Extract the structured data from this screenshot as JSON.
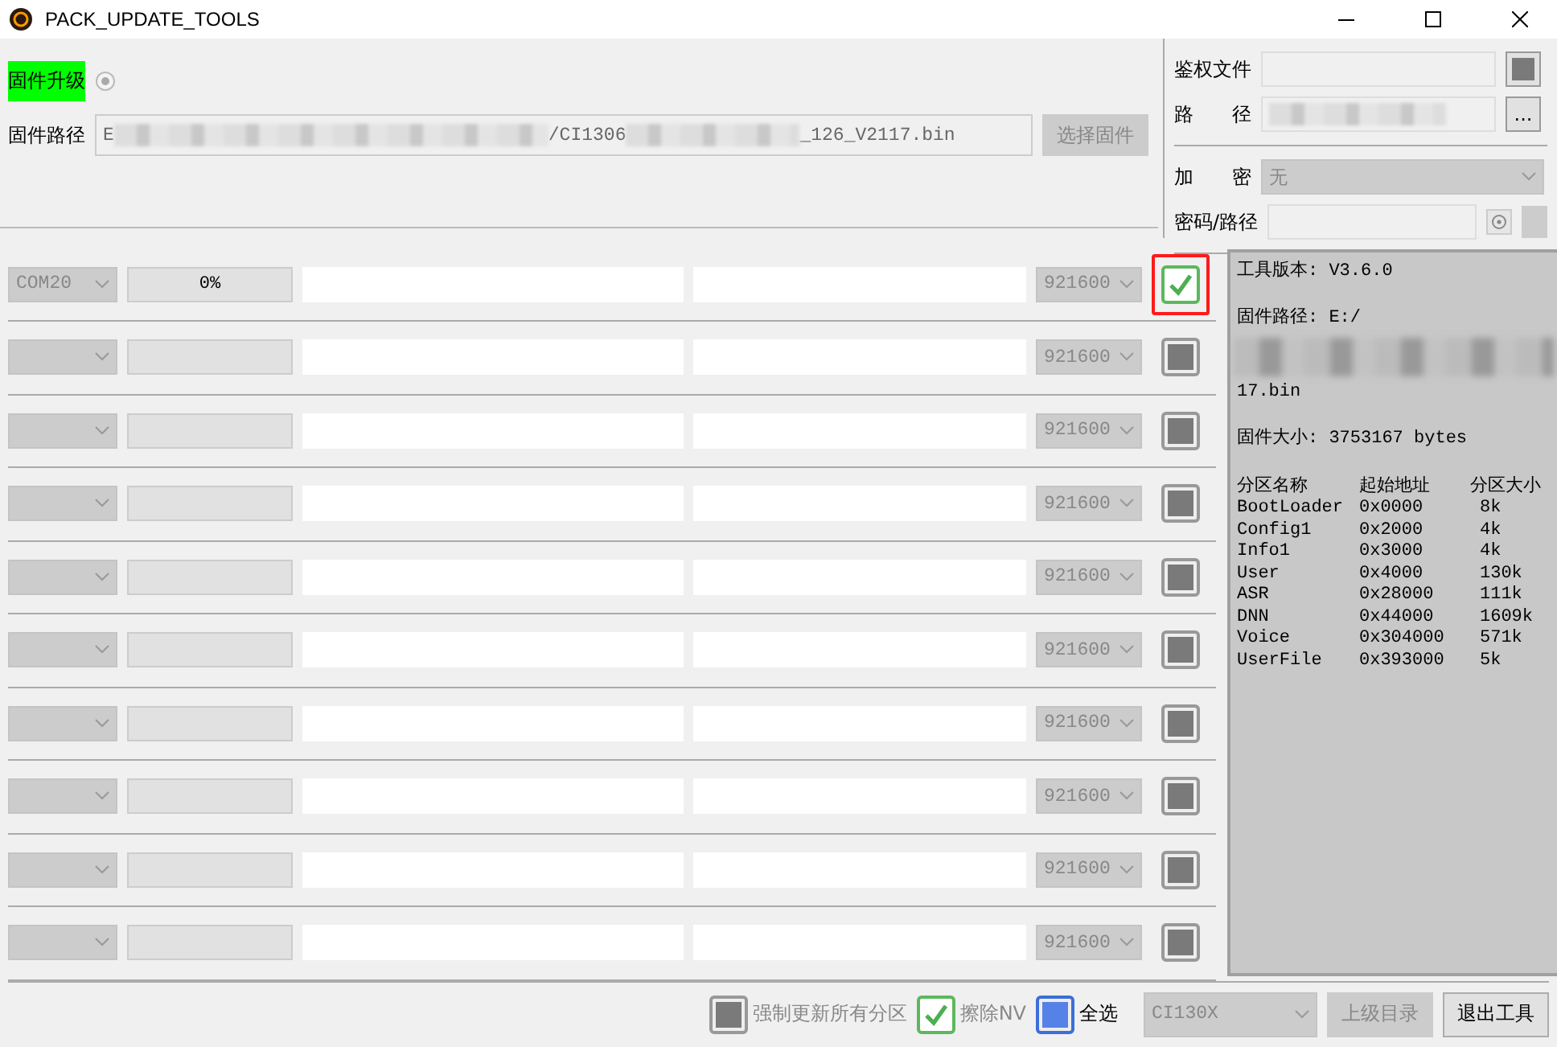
{
  "window": {
    "title": "PACK_UPDATE_TOOLS"
  },
  "firmware": {
    "upgrade_label": "固件升级",
    "upgrade_selected": true,
    "path_label": "固件路径",
    "path_parts": [
      "E",
      "/CI1306",
      "_126_V2117.bin"
    ],
    "choose_button": "选择固件"
  },
  "auth": {
    "file_label": "鉴权文件",
    "path_label": "路　　径",
    "path_button": "...",
    "encrypt_label": "加　　密",
    "encrypt_value": "无",
    "password_label": "密码/路径"
  },
  "rows": [
    {
      "port": "COM20",
      "progress": "0%",
      "baud": "921600",
      "checked": true,
      "highlighted": true
    },
    {
      "port": "",
      "progress": "",
      "baud": "921600",
      "checked": false,
      "highlighted": false
    },
    {
      "port": "",
      "progress": "",
      "baud": "921600",
      "checked": false,
      "highlighted": false
    },
    {
      "port": "",
      "progress": "",
      "baud": "921600",
      "checked": false,
      "highlighted": false
    },
    {
      "port": "",
      "progress": "",
      "baud": "921600",
      "checked": false,
      "highlighted": false
    },
    {
      "port": "",
      "progress": "",
      "baud": "921600",
      "checked": false,
      "highlighted": false
    },
    {
      "port": "",
      "progress": "",
      "baud": "921600",
      "checked": false,
      "highlighted": false
    },
    {
      "port": "",
      "progress": "",
      "baud": "921600",
      "checked": false,
      "highlighted": false
    },
    {
      "port": "",
      "progress": "",
      "baud": "921600",
      "checked": false,
      "highlighted": false
    },
    {
      "port": "",
      "progress": "",
      "baud": "921600",
      "checked": false,
      "highlighted": false
    }
  ],
  "info": {
    "tool_version": "工具版本: V3.6.0",
    "path_start": "固件路径: E:/",
    "path_end": "17.bin",
    "size": "固件大小: 3753167 bytes",
    "columns": [
      "分区名称",
      "起始地址",
      "分区大小"
    ],
    "partitions": [
      [
        "BootLoader",
        "0x0000",
        "8k"
      ],
      [
        "Config1",
        "0x2000",
        "4k"
      ],
      [
        "Info1",
        "0x3000",
        "4k"
      ],
      [
        "User",
        "0x4000",
        "130k"
      ],
      [
        "ASR",
        "0x28000",
        "111k"
      ],
      [
        "DNN",
        "0x44000",
        "1609k"
      ],
      [
        "Voice",
        "0x304000",
        "571k"
      ],
      [
        "UserFile",
        "0x393000",
        "5k"
      ]
    ]
  },
  "footer": {
    "checkboxes": [
      {
        "label": "强制更新所有分区",
        "checked": false,
        "indeterminate": false,
        "disabled": true
      },
      {
        "label": "擦除NV",
        "checked": true,
        "indeterminate": false,
        "disabled": true
      },
      {
        "label": "全选",
        "checked": false,
        "indeterminate": true,
        "disabled": false
      }
    ],
    "chip": "CI130X",
    "parent_button": "上级目录",
    "exit_button": "退出工具"
  }
}
